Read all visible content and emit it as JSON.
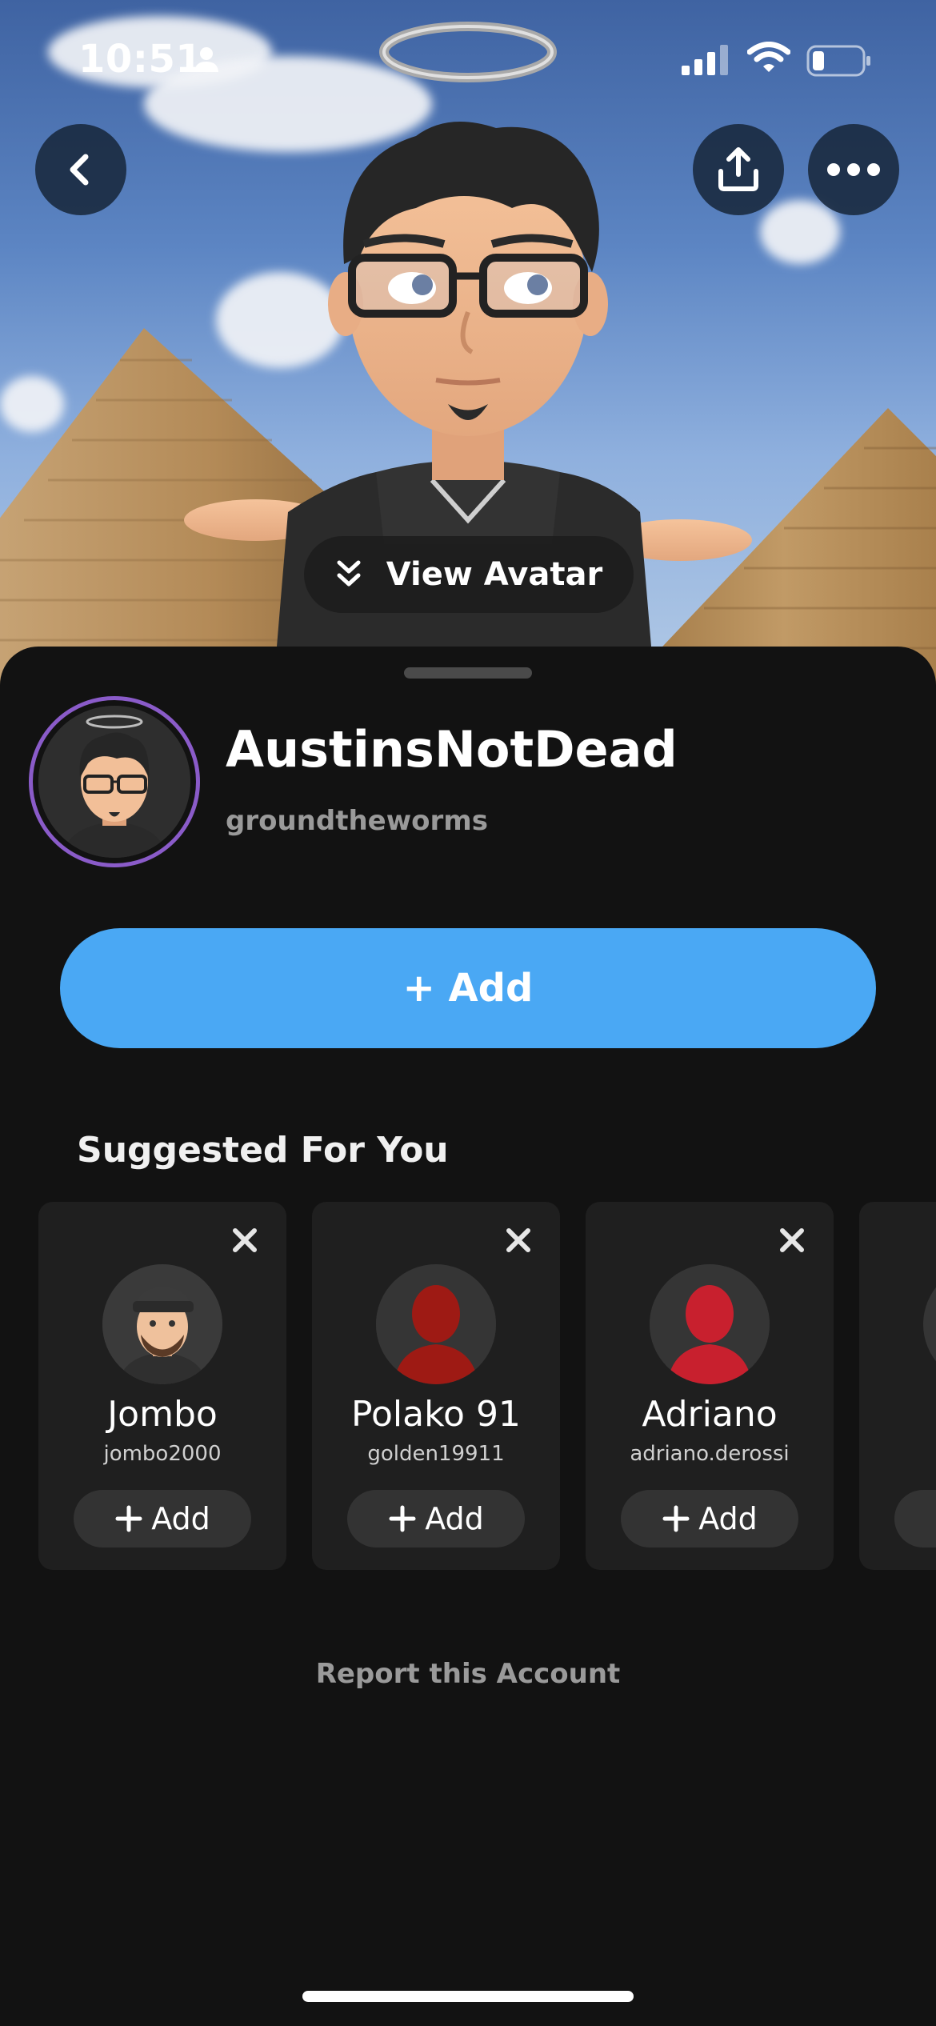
{
  "status_bar": {
    "time": "10:51"
  },
  "hero": {
    "view_avatar_label": "View Avatar",
    "back_icon": "chevron-left-icon",
    "share_icon": "share-icon",
    "more_icon": "more-dots-icon"
  },
  "profile": {
    "display_name": "AustinsNotDead",
    "username": "groundtheworms",
    "add_label": "+ Add"
  },
  "suggested": {
    "title": "Suggested For You",
    "items": [
      {
        "name": "Jombo",
        "username": "jombo2000",
        "add_label": "Add",
        "avatar": "bitmoji"
      },
      {
        "name": "Polako 91",
        "username": "golden19911",
        "add_label": "Add",
        "avatar": "silhouette-dark-red"
      },
      {
        "name": "Adriano",
        "username": "adriano.derossi",
        "add_label": "Add",
        "avatar": "silhouette-red"
      }
    ]
  },
  "footer": {
    "report_label": "Report this Account"
  },
  "colors": {
    "accent_blue": "#4aa8f4",
    "avatar_ring": "#8a5bc9",
    "background": "#121212",
    "card": "#1f1f1f"
  }
}
